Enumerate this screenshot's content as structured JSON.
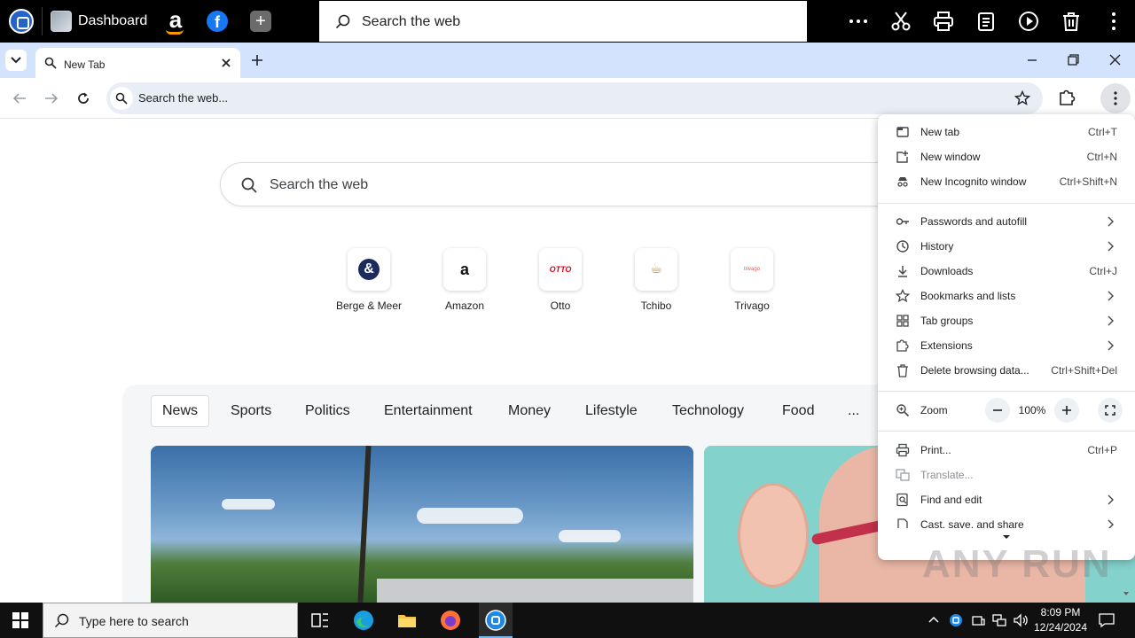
{
  "topbar": {
    "dashboard_label": "Dashboard",
    "search_placeholder": "Search the web",
    "amazon_glyph": "a",
    "facebook_glyph": "f",
    "add_glyph": "+"
  },
  "browser": {
    "tab_title": "New Tab",
    "omnibox_text": "Search the web..."
  },
  "ntp": {
    "search_placeholder": "Search the web",
    "shortcuts": [
      {
        "label": "Berge & Meer",
        "glyph": "&"
      },
      {
        "label": "Amazon",
        "glyph": "a"
      },
      {
        "label": "Otto",
        "glyph": "OTTO"
      },
      {
        "label": "Tchibo",
        "glyph": "☕"
      },
      {
        "label": "Trivago",
        "glyph": "trivago"
      }
    ],
    "feed_tabs": [
      "News",
      "Sports",
      "Politics",
      "Entertainment",
      "Money",
      "Lifestyle",
      "Technology",
      "Food",
      "..."
    ]
  },
  "menu": {
    "items": [
      {
        "label": "New tab",
        "shortcut": "Ctrl+T",
        "icon": "new-tab-icon"
      },
      {
        "label": "New window",
        "shortcut": "Ctrl+N",
        "icon": "new-window-icon"
      },
      {
        "label": "New Incognito window",
        "shortcut": "Ctrl+Shift+N",
        "icon": "incognito-icon"
      },
      {
        "label": "Passwords and autofill",
        "shortcut": "",
        "icon": "key-icon"
      },
      {
        "label": "History",
        "shortcut": "",
        "icon": "history-icon"
      },
      {
        "label": "Downloads",
        "shortcut": "Ctrl+J",
        "icon": "download-icon"
      },
      {
        "label": "Bookmarks and lists",
        "shortcut": "",
        "icon": "star-icon"
      },
      {
        "label": "Tab groups",
        "shortcut": "",
        "icon": "tab-groups-icon"
      },
      {
        "label": "Extensions",
        "shortcut": "",
        "icon": "puzzle-icon"
      },
      {
        "label": "Delete browsing data...",
        "shortcut": "Ctrl+Shift+Del",
        "icon": "trash-icon"
      },
      {
        "label": "Zoom",
        "shortcut": "",
        "icon": "zoom-icon"
      },
      {
        "label": "Print...",
        "shortcut": "Ctrl+P",
        "icon": "print-icon"
      },
      {
        "label": "Translate...",
        "shortcut": "",
        "icon": "translate-icon"
      },
      {
        "label": "Find and edit",
        "shortcut": "",
        "icon": "find-icon"
      },
      {
        "label": "Cast, save, and share",
        "shortcut": "",
        "icon": "cast-icon"
      }
    ],
    "zoom_value": "100%"
  },
  "watermark": "ANY RUN",
  "taskbar": {
    "search_placeholder": "Type here to search",
    "time": "8:09 PM",
    "date": "12/24/2024"
  },
  "colors": {
    "tabstrip": "#d3e3fd",
    "omnibox": "#e9eef6",
    "taskbar": "#101010"
  }
}
